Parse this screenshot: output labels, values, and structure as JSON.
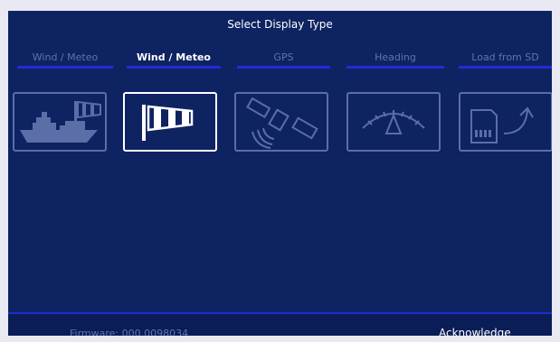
{
  "dialog": {
    "title": "Select Display Type"
  },
  "tabs": [
    {
      "label": "Wind / Meteo",
      "active": false
    },
    {
      "label": "Wind / Meteo",
      "active": true
    },
    {
      "label": "GPS",
      "active": false
    },
    {
      "label": "Heading",
      "active": false
    },
    {
      "label": "Load from SD",
      "active": false
    }
  ],
  "cards": [
    {
      "icon": "ship-windsock-icon",
      "selected": false
    },
    {
      "icon": "windsock-icon",
      "selected": true
    },
    {
      "icon": "satellite-icon",
      "selected": false
    },
    {
      "icon": "compass-gauge-icon",
      "selected": false
    },
    {
      "icon": "sd-card-load-icon",
      "selected": false
    }
  ],
  "footer": {
    "firmware": "Firmware: 000.0098034",
    "acknowledge_label": "Acknowledge"
  },
  "colors": {
    "background": "#0e2361",
    "accent": "#1f2cd8",
    "inactive": "#5e73b0",
    "active": "#ffffff"
  }
}
